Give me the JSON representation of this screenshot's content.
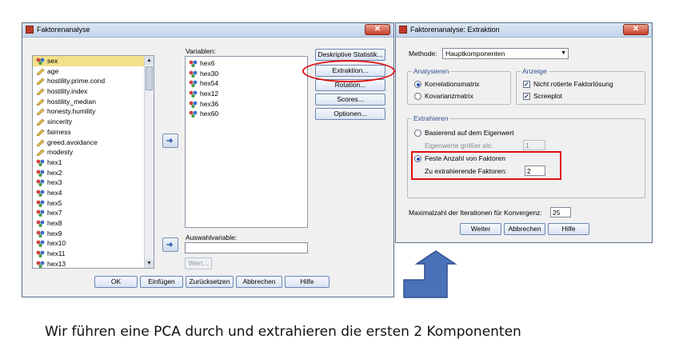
{
  "left_dialog": {
    "title": "Faktorenanalyse",
    "close_label": "✕",
    "source_vars": [
      {
        "name": "sex",
        "type": "nominal",
        "selected": true
      },
      {
        "name": "age",
        "type": "scale"
      },
      {
        "name": "hostility.prime.cond",
        "type": "scale"
      },
      {
        "name": "hostility.index",
        "type": "scale"
      },
      {
        "name": "hostility_median",
        "type": "scale"
      },
      {
        "name": "honesty.humility",
        "type": "scale"
      },
      {
        "name": "sincerity",
        "type": "scale"
      },
      {
        "name": "fairness",
        "type": "scale"
      },
      {
        "name": "greed.avoidance",
        "type": "scale"
      },
      {
        "name": "modesty",
        "type": "scale"
      },
      {
        "name": "hex1",
        "type": "nominal"
      },
      {
        "name": "hex2",
        "type": "nominal"
      },
      {
        "name": "hex3",
        "type": "nominal"
      },
      {
        "name": "hex4",
        "type": "nominal"
      },
      {
        "name": "hex5",
        "type": "nominal"
      },
      {
        "name": "hex7",
        "type": "nominal"
      },
      {
        "name": "hex8",
        "type": "nominal"
      },
      {
        "name": "hex9",
        "type": "nominal"
      },
      {
        "name": "hex10",
        "type": "nominal"
      },
      {
        "name": "hex11",
        "type": "nominal"
      },
      {
        "name": "hex13",
        "type": "nominal"
      }
    ],
    "variables_label": "Variablen:",
    "variables": [
      "hex6",
      "hex30",
      "hex54",
      "hex12",
      "hex36",
      "hex60"
    ],
    "selection_label": "Auswahlvariable:",
    "selection_value": "",
    "value_button": "Wert...",
    "side_buttons": [
      "Deskriptive Statistik...",
      "Extraktion...",
      "Rotation...",
      "Scores...",
      "Optionen..."
    ],
    "bottom_buttons": [
      "OK",
      "Einfügen",
      "Zurücksetzen",
      "Abbrechen",
      "Hilfe"
    ]
  },
  "right_dialog": {
    "title": "Faktorenanalyse: Extraktion",
    "close_label": "✕",
    "method_label": "Methode:",
    "method_value": "Hauptkomponenten",
    "analyze_group": "Analysieren",
    "analyze_options": [
      {
        "label": "Korrelationsmatrix",
        "checked": true
      },
      {
        "label": "Kovarianzmatrix",
        "checked": false
      }
    ],
    "display_group": "Anzeige",
    "display_options": [
      {
        "label": "Nicht rotierte Faktorlösung",
        "checked": true
      },
      {
        "label": "Screeplot",
        "checked": true
      }
    ],
    "extract_group": "Extrahieren",
    "eigen_radio": "Basierend auf dem Eigenwert",
    "eigen_label": "Eigenwerte größer als:",
    "eigen_value": "1",
    "fixed_radio": "Feste Anzahl von Faktoren",
    "fixed_label": "Zu extrahierende Faktoren:",
    "fixed_value": "2",
    "iter_label": "Maximalzahl der Iterationen für Konvergenz:",
    "iter_value": "25",
    "buttons": [
      "Weiter",
      "Abbrechen",
      "Hilfe"
    ]
  },
  "caption": "Wir führen eine PCA durch und extrahieren die ersten 2 Komponenten",
  "colors": {
    "highlight": "#e01010",
    "arrow": "#4a72b8"
  }
}
